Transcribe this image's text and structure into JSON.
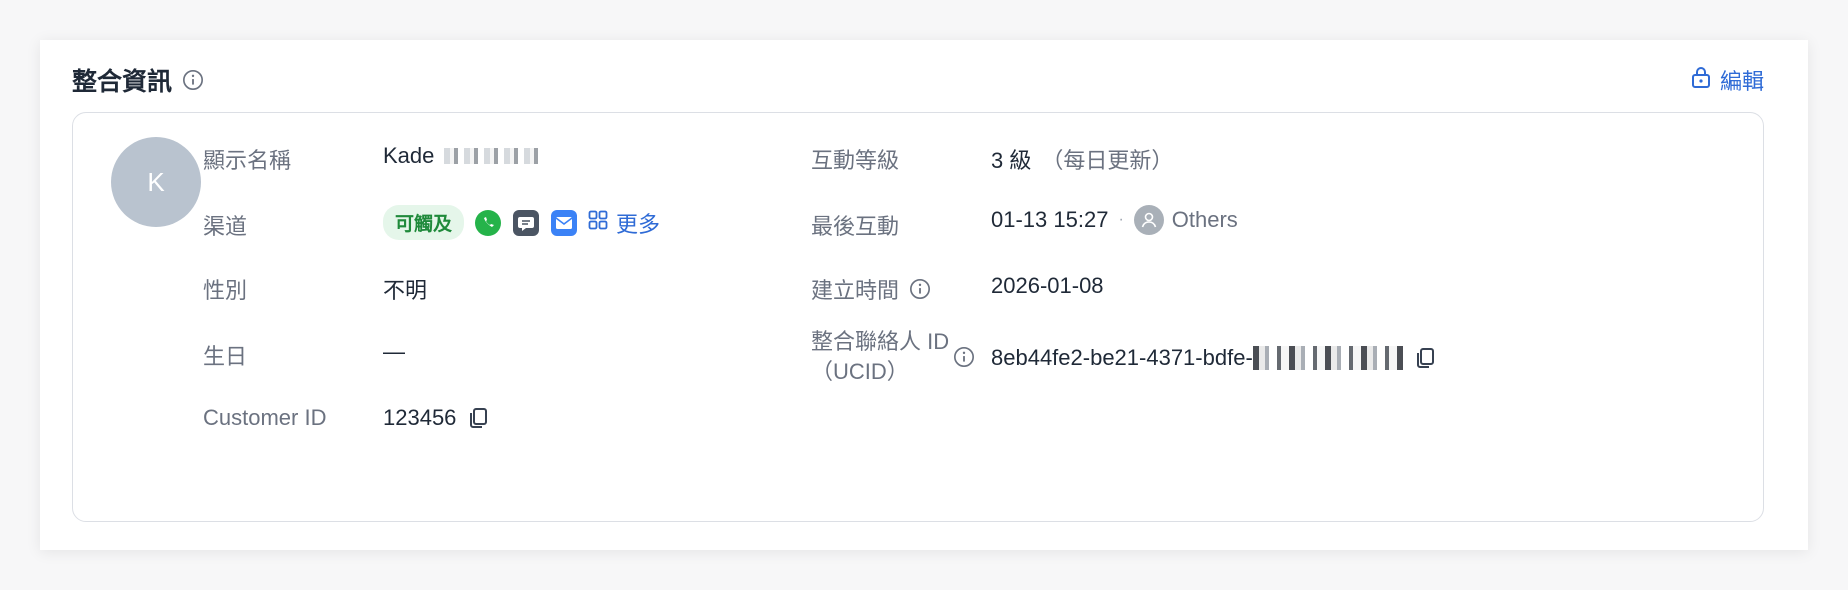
{
  "header": {
    "title": "整合資訊",
    "edit_label": "編輯"
  },
  "avatar": {
    "initial": "K"
  },
  "left_fields": {
    "display_name_label": "顯示名稱",
    "display_name_value": "Kade",
    "channel_label": "渠道",
    "channel_tag": "可觸及",
    "channel_more": "更多",
    "gender_label": "性別",
    "gender_value": "不明",
    "birthday_label": "生日",
    "birthday_value": "—",
    "customer_id_label": "Customer ID",
    "customer_id_value": "123456"
  },
  "right_fields": {
    "level_label": "互動等級",
    "level_value": "3 級",
    "level_note": "（每日更新）",
    "last_interaction_label": "最後互動",
    "last_interaction_time": "01-13 15:27",
    "last_interaction_sep": "·",
    "last_interaction_user": "Others",
    "created_label": "建立時間",
    "created_value": "2026-01-08",
    "ucid_label_line1": "整合聯絡人 ID",
    "ucid_label_line2": "（UCID）",
    "ucid_value": "8eb44fe2-be21-4371-bdfe-"
  },
  "colors": {
    "accent": "#2f6bd6",
    "whatsapp": "#25b34a",
    "sms": "#4b5563",
    "email": "#3b82f6",
    "tag_bg": "#e5f6ea",
    "tag_text": "#1f8a3b",
    "avatar_bg": "#b9c3cf"
  }
}
